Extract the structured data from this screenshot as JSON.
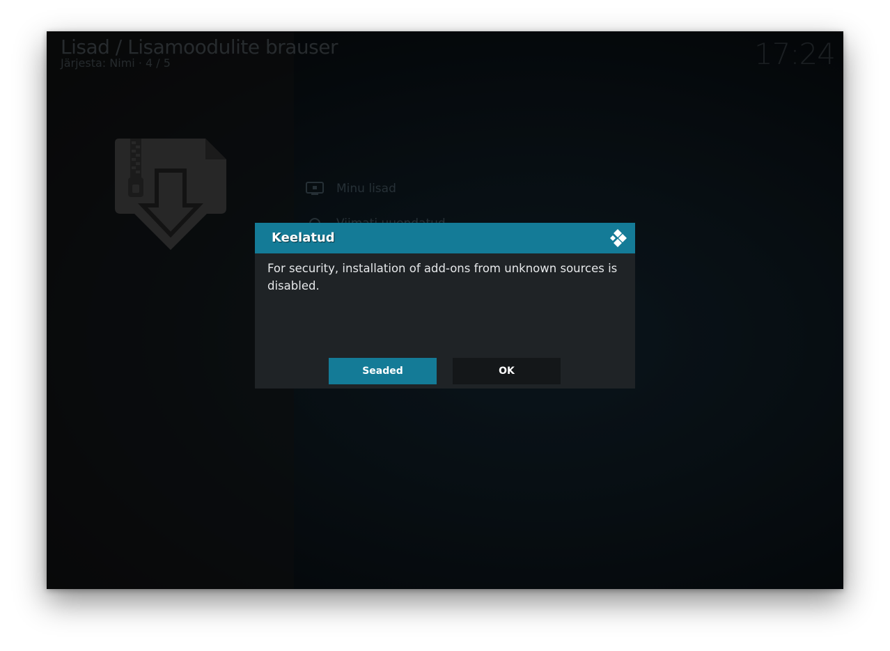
{
  "header": {
    "title": "Lisad / Lisamoodulite brauser",
    "subtitle": "Järjesta: Nimi  ·  4 / 5",
    "clock": "17:24"
  },
  "left_panel": {
    "icon": "addon-zip-download-icon"
  },
  "menu": {
    "items": [
      {
        "label": "Minu lisad",
        "icon": "tv-icon"
      },
      {
        "label": "Viimati uuendatud",
        "icon": "refresh-icon"
      }
    ]
  },
  "dialog": {
    "title": "Keelatud",
    "logo": "kodi-logo-icon",
    "message": "For security, installation of add-ons from unknown sources is disabled.",
    "buttons": {
      "settings_label": "Seaded",
      "ok_label": "OK"
    }
  },
  "colors": {
    "accent": "#147b97",
    "dialog_bg": "#1f2326",
    "button_dark": "#141719"
  }
}
